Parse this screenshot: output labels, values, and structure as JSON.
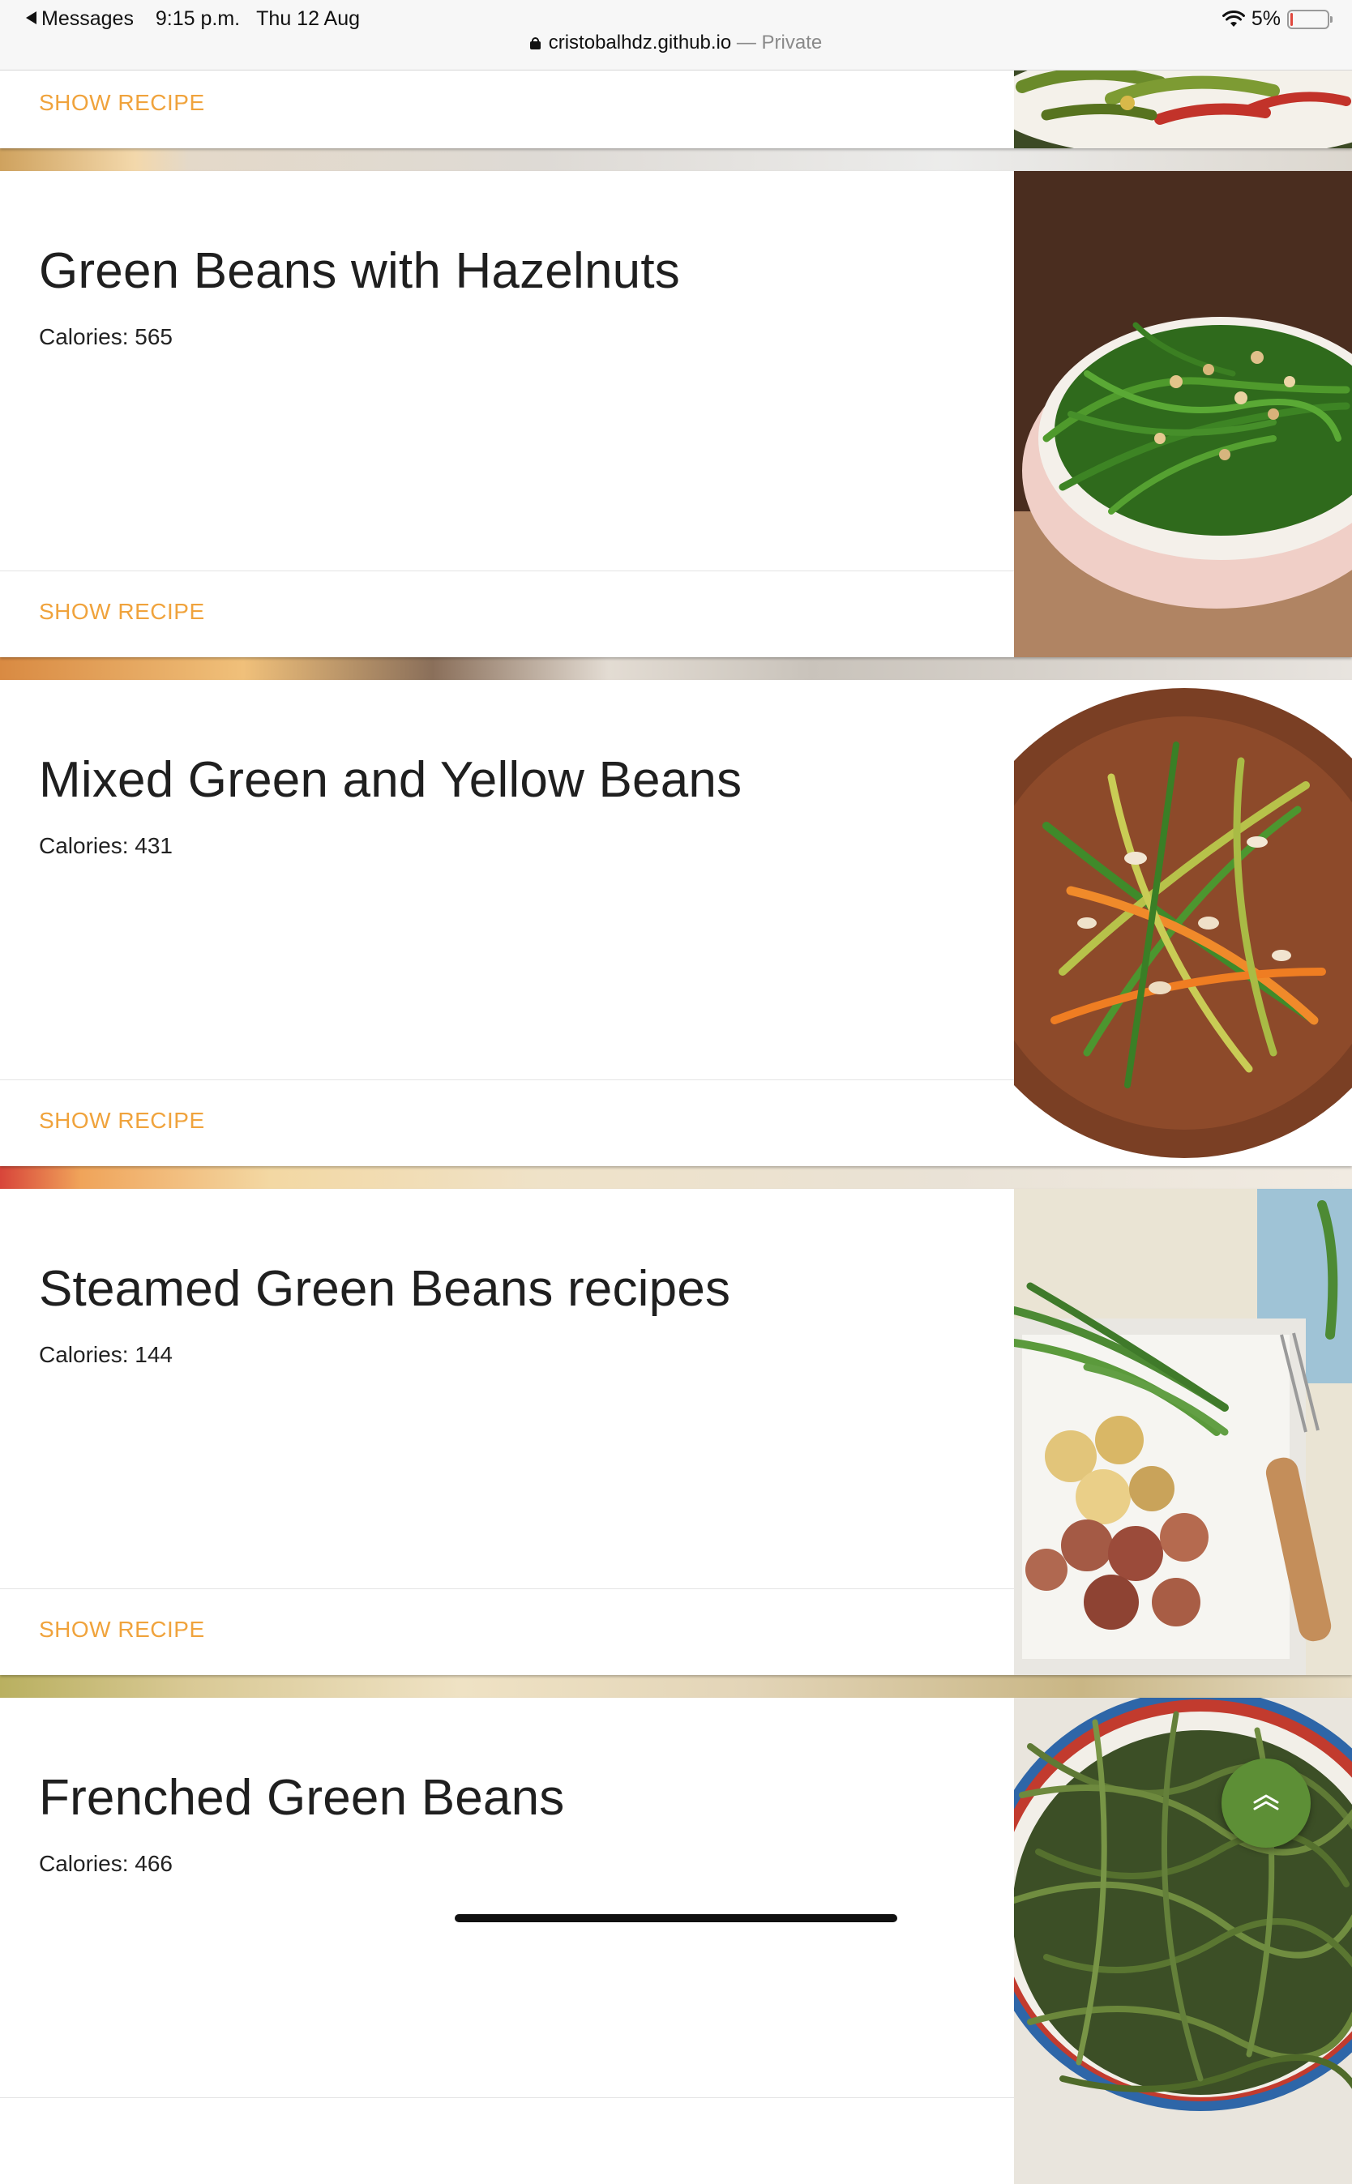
{
  "status_bar": {
    "back_app": "Messages",
    "time": "9:15 p.m.",
    "date": "Thu 12 Aug",
    "battery": "5%",
    "wifi_icon": "wifi-icon",
    "battery_icon": "battery-icon"
  },
  "url_bar": {
    "domain": "cristobalhdz.github.io",
    "separator": " — ",
    "mode": "Private",
    "lock_icon": "lock-icon"
  },
  "cards": [
    {
      "title": "",
      "calories_label": "",
      "action_label": "SHOW RECIPE"
    },
    {
      "title": "Green Beans with Hazelnuts",
      "calories_label": "Calories: 565",
      "action_label": "SHOW RECIPE"
    },
    {
      "title": "Mixed Green and Yellow Beans",
      "calories_label": "Calories: 431",
      "action_label": "SHOW RECIPE"
    },
    {
      "title": "Steamed Green Beans recipes",
      "calories_label": "Calories: 144",
      "action_label": "SHOW RECIPE"
    },
    {
      "title": "Frenched Green Beans",
      "calories_label": "Calories: 466",
      "action_label": ""
    }
  ],
  "scroll_top_button": {
    "icon": "chevron-up-double-icon"
  },
  "colors": {
    "action_text": "#f0a33c",
    "fab_background": "#5d8f36",
    "title_text": "#1f1f1f"
  }
}
